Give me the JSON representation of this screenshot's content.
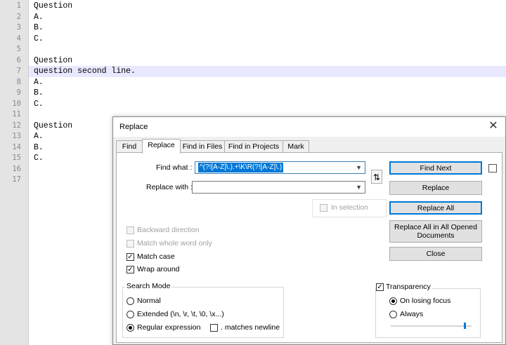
{
  "editor": {
    "lines": [
      {
        "num": "1",
        "text": "Question"
      },
      {
        "num": "2",
        "text": "A."
      },
      {
        "num": "3",
        "text": "B."
      },
      {
        "num": "4",
        "text": "C."
      },
      {
        "num": "5",
        "text": ""
      },
      {
        "num": "6",
        "text": "Question"
      },
      {
        "num": "7",
        "text": "question second line."
      },
      {
        "num": "8",
        "text": "A."
      },
      {
        "num": "9",
        "text": "B."
      },
      {
        "num": "10",
        "text": "C."
      },
      {
        "num": "11",
        "text": ""
      },
      {
        "num": "12",
        "text": "Question"
      },
      {
        "num": "13",
        "text": "A."
      },
      {
        "num": "14",
        "text": "B."
      },
      {
        "num": "15",
        "text": "C."
      },
      {
        "num": "16",
        "text": ""
      },
      {
        "num": "17",
        "text": ""
      }
    ],
    "current_line": "7"
  },
  "dialog": {
    "title": "Replace",
    "close_glyph": "✕",
    "tabs": [
      {
        "label": "Find"
      },
      {
        "label": "Replace"
      },
      {
        "label": "Find in Files"
      },
      {
        "label": "Find in Projects"
      },
      {
        "label": "Mark"
      }
    ],
    "active_tab": "Replace",
    "find_label": "Find what :",
    "find_value": "^(?![A-Z]\\.).+\\K\\R(?![A-Z]\\.)",
    "replace_label": "Replace with :",
    "replace_value": "",
    "swap_glyph": "⇅",
    "in_selection_label": "In selection",
    "buttons": {
      "find_next": "Find Next",
      "replace": "Replace",
      "replace_all": "Replace All",
      "replace_all_docs": "Replace All in All Opened Documents",
      "close": "Close"
    },
    "options": {
      "backward": {
        "label": "Backward direction",
        "checked": false,
        "enabled": false
      },
      "whole_word": {
        "label": "Match whole word only",
        "checked": false,
        "enabled": false
      },
      "match_case": {
        "label": "Match case",
        "checked": true,
        "enabled": true
      },
      "wrap_around": {
        "label": "Wrap around",
        "checked": true,
        "enabled": true
      }
    },
    "search_mode": {
      "legend": "Search Mode",
      "normal": "Normal",
      "extended": "Extended (\\n, \\r, \\t, \\0, \\x...)",
      "regex": "Regular expression",
      "matches_newline": ". matches newline",
      "selected": "regex"
    },
    "transparency": {
      "label": "Transparency",
      "checked": true,
      "on_losing_focus": "On losing focus",
      "always": "Always",
      "selected": "on_losing_focus",
      "level": 0.9
    },
    "check_glyph": "✓",
    "colors": {
      "selection": "#0078d7",
      "current_line": "#e8e8ff"
    }
  }
}
